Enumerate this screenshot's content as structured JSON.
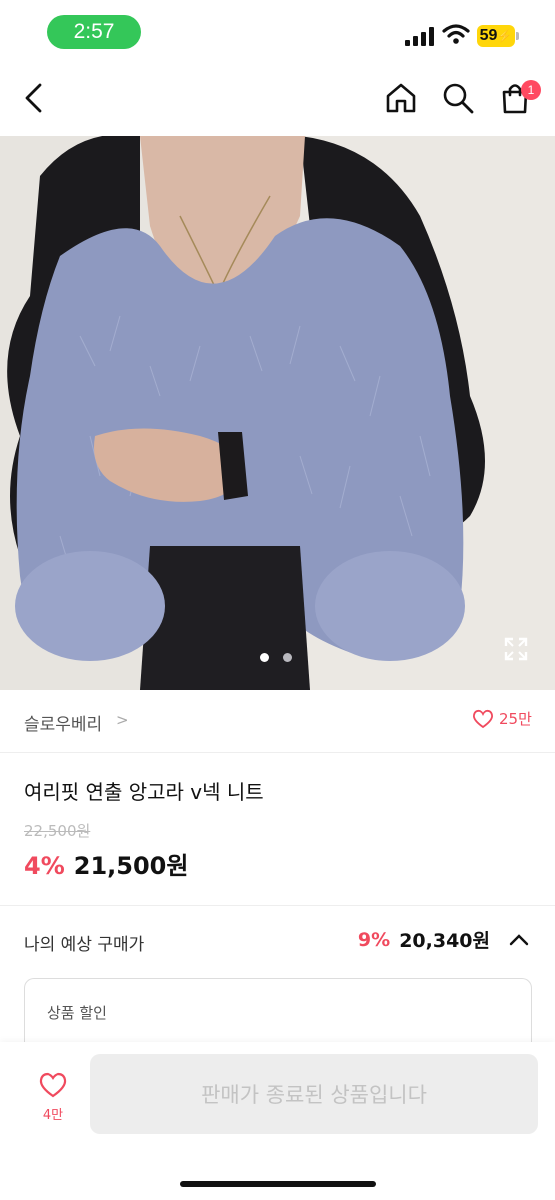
{
  "status": {
    "time": "2:57",
    "battery": "59"
  },
  "nav": {
    "back_icon": "chevron-left-icon",
    "home_icon": "home-icon",
    "search_icon": "search-icon",
    "cart_icon": "shopping-bag-icon",
    "cart_badge": "1"
  },
  "gallery": {
    "image_count": 2,
    "active_index": 0,
    "expand_icon": "expand-icon"
  },
  "brand": {
    "name": "슬로우베리",
    "chevron": ">",
    "likes": "25만"
  },
  "product": {
    "title": "여리핏 연출 앙고라 v넥 니트",
    "original_price": "22,500원",
    "discount": "4%",
    "price": "21,500원"
  },
  "estimate": {
    "label": "나의 예상 구매가",
    "discount": "9%",
    "price": "20,340원",
    "toggle_icon": "chevron-up-icon"
  },
  "discount_box": {
    "label": "상품 할인"
  },
  "bottom": {
    "wish_count": "4만",
    "button_label": "판매가 종료된 상품입니다"
  },
  "colors": {
    "accent": "#f04a5e",
    "status_pill": "#34c759",
    "battery": "#ffd60a",
    "sweater": "#8e99c0"
  }
}
